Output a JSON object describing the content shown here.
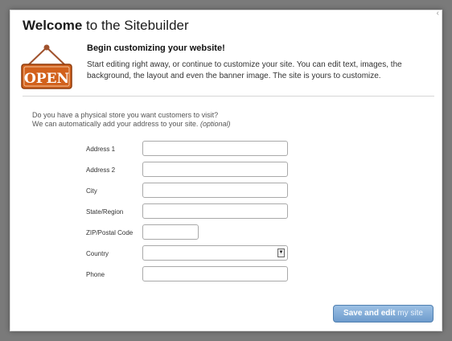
{
  "dialog": {
    "title_bold": "Welcome",
    "title_rest": " to the Sitebuilder",
    "sign_text": "OPEN",
    "intro_heading": "Begin customizing your website!",
    "intro_text": "Start editing right away, or continue to customize your site. You can edit text, images, the background, the layout and even the banner image. The site is yours to customize."
  },
  "address_form": {
    "question_line1": "Do you have a physical store you want customers to visit?",
    "question_line2": "We can automatically add your address to your site.",
    "optional_note": "(optional)",
    "fields": [
      {
        "label": "Address 1",
        "value": ""
      },
      {
        "label": "Address 2",
        "value": ""
      },
      {
        "label": "City",
        "value": ""
      },
      {
        "label": "State/Region",
        "value": ""
      },
      {
        "label": "ZIP/Postal Code",
        "value": ""
      },
      {
        "label": "Country",
        "value": ""
      },
      {
        "label": "Phone",
        "value": ""
      }
    ]
  },
  "footer": {
    "save_label_main": "Save and edit ",
    "save_label_light": "my site"
  },
  "colors": {
    "sign": "#d2611c",
    "button": "#7aa6d4",
    "background": "#7a7a7a"
  },
  "icons": {
    "sign": "open-sign-icon",
    "close": "close-icon",
    "select_arrow": "chevron-down-icon"
  }
}
